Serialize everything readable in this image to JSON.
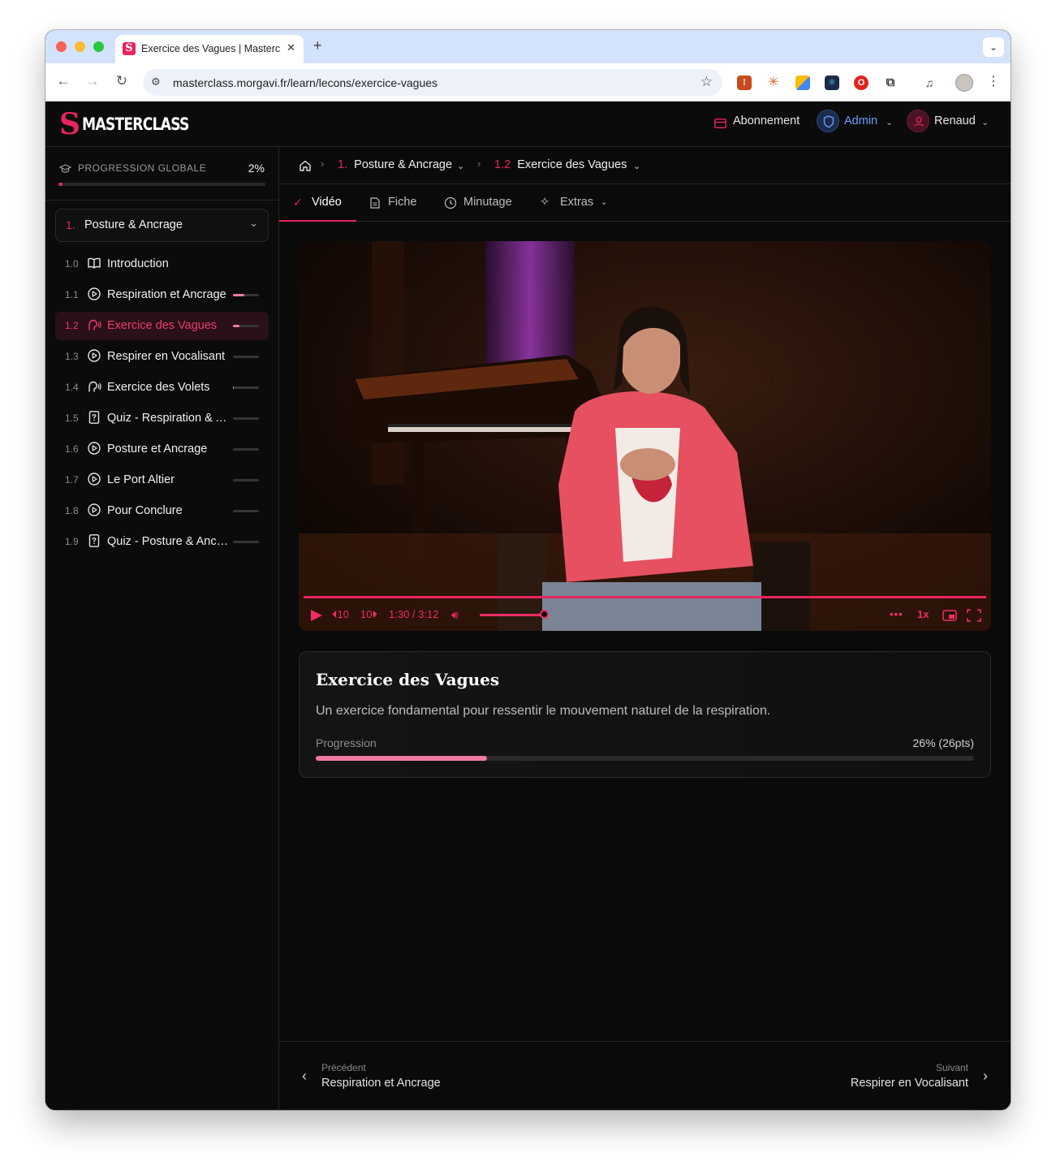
{
  "browser": {
    "tab_title": "Exercice des Vagues | Masterclass",
    "url": "masterclass.morgavi.fr/learn/lecons/exercice-vagues"
  },
  "header": {
    "logo_text": "MASTERCLASS",
    "subscription": "Abonnement",
    "admin": "Admin",
    "user": "Renaud"
  },
  "sidebar": {
    "progress_label": "PROGRESSION GLOBALE",
    "progress_pct": "2%",
    "progress_value": 0.02,
    "chapter": {
      "number": "1.",
      "title": "Posture & Ancrage"
    },
    "lessons": [
      {
        "num": "1.0",
        "title": "Introduction",
        "icon": "book-icon",
        "progress": null,
        "active": false
      },
      {
        "num": "1.1",
        "title": "Respiration et Ancrage",
        "icon": "play-circle-icon",
        "progress": 0.45,
        "active": false
      },
      {
        "num": "1.2",
        "title": "Exercice des Vagues",
        "icon": "voice-icon",
        "progress": 0.26,
        "active": true
      },
      {
        "num": "1.3",
        "title": "Respirer en Vocalisant",
        "icon": "play-circle-icon",
        "progress": 0,
        "active": false
      },
      {
        "num": "1.4",
        "title": "Exercice des Volets",
        "icon": "voice-icon",
        "progress": 0.03,
        "active": false
      },
      {
        "num": "1.5",
        "title": "Quiz - Respiration & Ancrage",
        "icon": "quiz-icon",
        "progress": 0,
        "active": false
      },
      {
        "num": "1.6",
        "title": "Posture et Ancrage",
        "icon": "play-circle-icon",
        "progress": 0,
        "active": false
      },
      {
        "num": "1.7",
        "title": "Le Port Altier",
        "icon": "play-circle-icon",
        "progress": 0,
        "active": false
      },
      {
        "num": "1.8",
        "title": "Pour Conclure",
        "icon": "play-circle-icon",
        "progress": 0,
        "active": false
      },
      {
        "num": "1.9",
        "title": "Quiz - Posture & Ancrage",
        "icon": "quiz-icon",
        "progress": 0,
        "active": false
      }
    ]
  },
  "breadcrumb": {
    "chapter_num": "1.",
    "chapter": "Posture & Ancrage",
    "lesson_num": "1.2",
    "lesson": "Exercice des Vagues"
  },
  "tabs": {
    "video": "Vidéo",
    "fiche": "Fiche",
    "minutage": "Minutage",
    "extras": "Extras"
  },
  "player": {
    "rewind": "10",
    "forward": "10",
    "time": "1:30 / 3:12",
    "speed": "1x",
    "playback_progress": 0.47,
    "volume": 0.78
  },
  "lesson_card": {
    "title": "Exercice des Vagues",
    "description": "Un exercice fondamental pour ressentir le mouvement naturel de la respiration.",
    "progress_label": "Progression",
    "progress_text": "26% (26pts)",
    "progress_value": 0.26
  },
  "footer_nav": {
    "prev_label": "Précédent",
    "prev_title": "Respiration et Ancrage",
    "next_label": "Suivant",
    "next_title": "Respirer en Vocalisant"
  },
  "colors": {
    "accent": "#e8245f",
    "accent_light": "#f27aa0",
    "background": "#0a0a0a"
  }
}
